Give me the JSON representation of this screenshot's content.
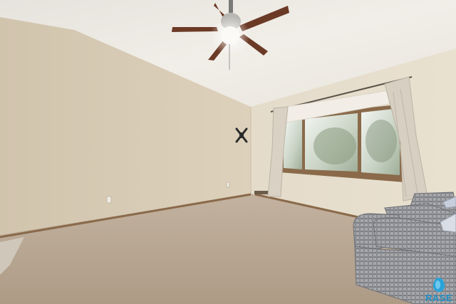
{
  "photo": {
    "subject": "empty-bedroom-interior"
  },
  "watermark": {
    "brand_text": "RASE",
    "color": "#1f8fc6"
  },
  "colors": {
    "ceiling": "#ece9e3",
    "left_wall": "#d9ccb6",
    "back_wall": "#e3dac8",
    "carpet": "#b9a894",
    "trim": "#8a6a4a",
    "fan_blade": "#6b3a26",
    "curtain": "#d6cfc2",
    "chair_plaid": "#8d8f94"
  }
}
